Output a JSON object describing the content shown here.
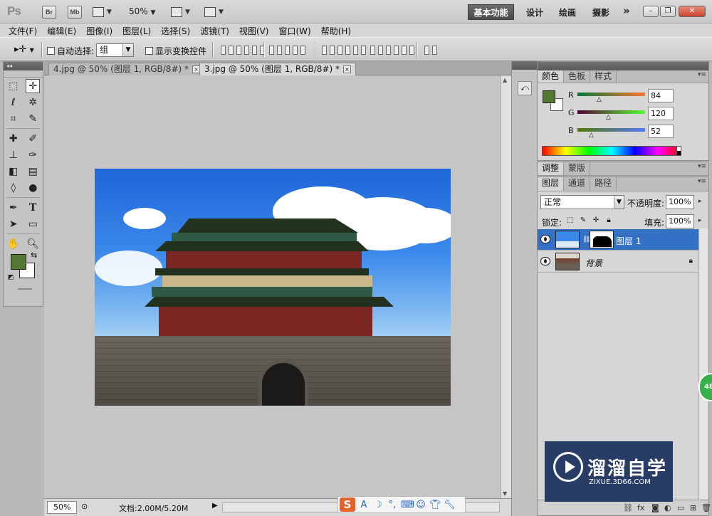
{
  "app": {
    "logo": "Ps",
    "bridge_label": "Br",
    "minibridge_label": "Mb",
    "zoom": "50%",
    "workspaces": [
      "基本功能",
      "设计",
      "绘画",
      "摄影"
    ],
    "more": "»"
  },
  "menu": [
    "文件(F)",
    "编辑(E)",
    "图像(I)",
    "图层(L)",
    "选择(S)",
    "滤镜(T)",
    "视图(V)",
    "窗口(W)",
    "帮助(H)"
  ],
  "options": {
    "auto_select_label": "自动选择:",
    "auto_select_value": "组",
    "show_transform_label": "显示变换控件"
  },
  "documents": {
    "tabs": [
      {
        "label": "4.jpg @ 50% (图层 1, RGB/8#) *",
        "active": false
      },
      {
        "label": "3.jpg @ 50% (图层 1, RGB/8#) *",
        "active": true
      }
    ],
    "close_glyph": "×"
  },
  "colors": {
    "foreground": "#547834",
    "background": "#ffffff"
  },
  "color_panel": {
    "tabs": [
      "颜色",
      "色板",
      "样式"
    ],
    "r": {
      "label": "R",
      "value": "84"
    },
    "g": {
      "label": "G",
      "value": "120"
    },
    "b": {
      "label": "B",
      "value": "52"
    }
  },
  "adjust_panel": {
    "tabs": [
      "调整",
      "蒙版"
    ]
  },
  "layers_panel": {
    "tabs": [
      "图层",
      "通道",
      "路径"
    ],
    "blend_mode": "正常",
    "opacity_label": "不透明度:",
    "opacity_value": "100%",
    "lock_label": "锁定:",
    "fill_label": "填充:",
    "fill_value": "100%",
    "layers": [
      {
        "name": "图层 1",
        "selected": true
      },
      {
        "name": "背景",
        "selected": false
      }
    ]
  },
  "status": {
    "zoom": "50%",
    "doc_size": "文档:2.00M/5.20M"
  },
  "watermark": {
    "title": "溜溜自学",
    "url": "ZIXUE.3D66.COM"
  },
  "badge": "48"
}
